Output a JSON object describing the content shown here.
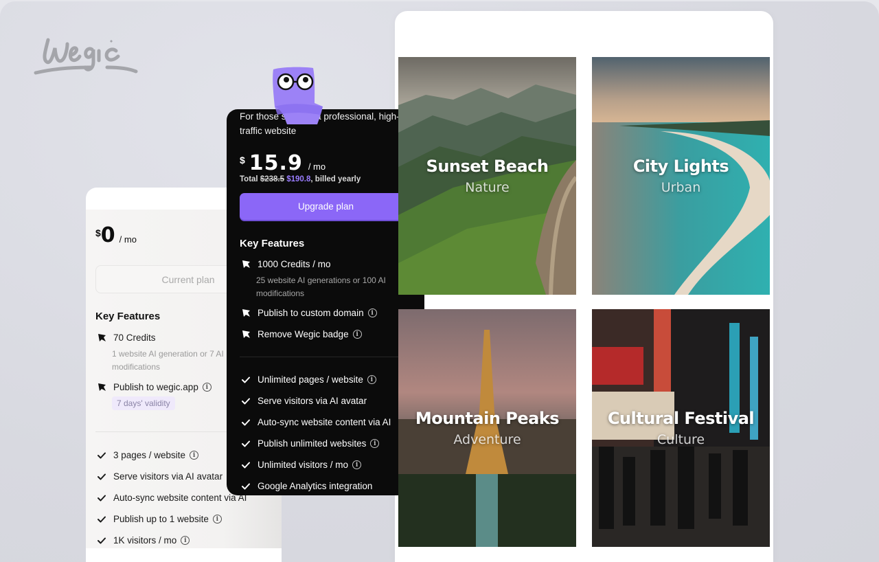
{
  "brand": {
    "logo_text": "Wegic"
  },
  "gallery": {
    "tiles": [
      {
        "title": "Sunset Beach",
        "subtitle": "Nature",
        "scene": "great-wall-mountains"
      },
      {
        "title": "City Lights",
        "subtitle": "Urban",
        "scene": "tropical-beach-aerial"
      },
      {
        "title": "Mountain Peaks",
        "subtitle": "Adventure",
        "scene": "eiffel-tower-dusk"
      },
      {
        "title": "Cultural Festival",
        "subtitle": "Culture",
        "scene": "neon-street-crowd"
      }
    ]
  },
  "free_plan": {
    "currency": "$",
    "price": "0",
    "period": "/ mo",
    "button_label": "Current plan",
    "key_features_title": "Key Features",
    "key_features": [
      {
        "label": "70 Credits",
        "sub": "1 website AI generation or 7 AI modifications",
        "info": false,
        "icon": "pin-icon"
      },
      {
        "label": "Publish to wegic.app",
        "info": true,
        "badge": "7 days' validity",
        "icon": "pin-icon"
      }
    ],
    "features": [
      {
        "label": "3 pages / website",
        "info": true
      },
      {
        "label": "Serve visitors via AI avatar",
        "info": false
      },
      {
        "label": "Auto-sync website content via AI",
        "info": false
      },
      {
        "label": "Publish up to 1 website",
        "info": true
      },
      {
        "label": "1K visitors / mo",
        "info": true
      }
    ]
  },
  "pro_plan": {
    "description": "For those seeking a professional, high-traffic website",
    "currency": "$",
    "price": "15.9",
    "period": "/ mo",
    "total_label": "Total",
    "total_original": "$238.5",
    "total_discounted": "$190.8",
    "total_suffix": ", billed yearly",
    "button_label": "Upgrade plan",
    "key_features_title": "Key Features",
    "key_features": [
      {
        "label": "1000 Credits / mo",
        "sub": "25 website AI generations or 100 AI modifications",
        "info": false
      },
      {
        "label": "Publish to custom domain",
        "info": true
      },
      {
        "label": "Remove Wegic badge",
        "info": true
      }
    ],
    "features": [
      {
        "label": "Unlimited pages / website",
        "info": true
      },
      {
        "label": "Serve visitors via AI avatar",
        "info": false
      },
      {
        "label": "Auto-sync website content via AI",
        "info": false
      },
      {
        "label": "Publish unlimited websites",
        "info": true
      },
      {
        "label": "Unlimited visitors / mo",
        "info": true
      },
      {
        "label": "Google Analytics integration",
        "info": false
      }
    ]
  },
  "colors": {
    "accent": "#8b67f7",
    "accent_text": "#9a7dff",
    "pro_bg": "#0b0b0b",
    "badge_bg": "#efe9fb"
  }
}
